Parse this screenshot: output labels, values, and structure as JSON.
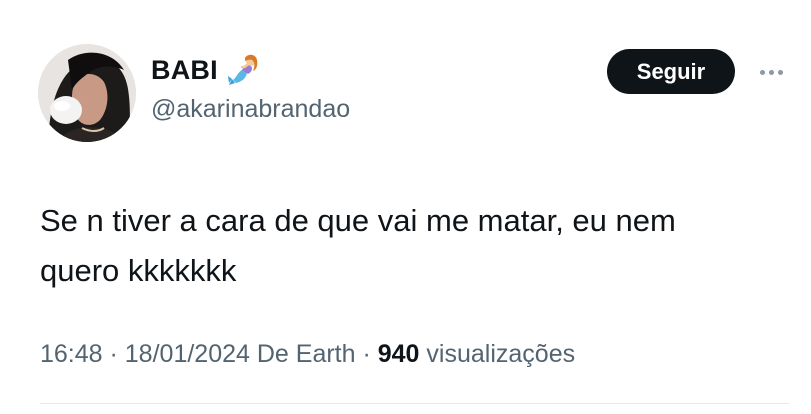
{
  "author": {
    "display_name": "BABI",
    "badge_emoji_icon": "mermaid-emoji",
    "handle": "@akarinabrandao",
    "avatar_icon": "profile-photo"
  },
  "actions": {
    "follow_label": "Seguir",
    "more_icon": "more-horizontal-icon"
  },
  "tweet": {
    "text": "Se n tiver a cara de que vai me matar, eu nem\nquero kkkkkkk"
  },
  "meta": {
    "time": "16:48",
    "separator": " · ",
    "date": "18/01/2024",
    "source": "De Earth",
    "views_count": "940",
    "views_label": "visualizações"
  },
  "colors": {
    "text_primary": "#0f1419",
    "text_secondary": "#536471",
    "button_bg": "#0f1419",
    "button_text": "#ffffff"
  }
}
